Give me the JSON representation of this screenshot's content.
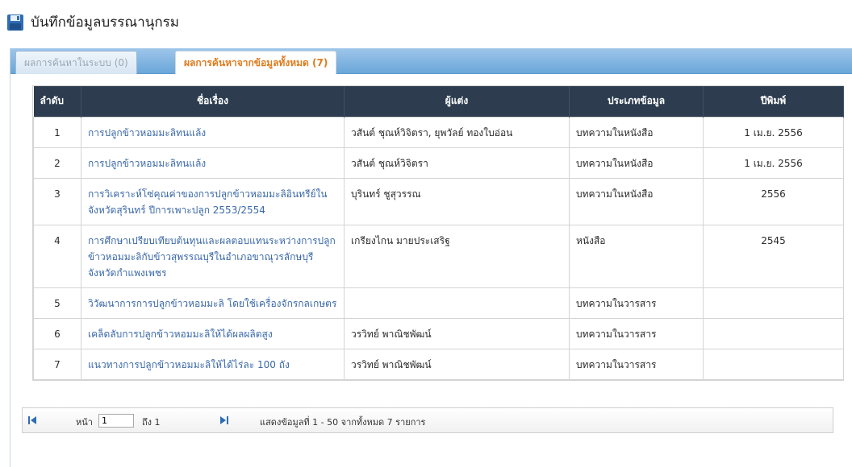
{
  "header": {
    "title": "บันทึกข้อมูลบรรณานุกรม",
    "icon": "save-icon"
  },
  "tabs": [
    {
      "label": "ผลการค้นหาในระบบ (0)",
      "active": false
    },
    {
      "label": "ผลการค้นหาจากข้อมูลทั้งหมด  (7)",
      "active": true
    }
  ],
  "table": {
    "columns": [
      "ลำดับ",
      "ชื่อเรื่อง",
      "ผู้แต่ง",
      "ประเภทข้อมูล",
      "ปีพิมพ์"
    ],
    "rows": [
      {
        "num": "1",
        "title": "การปลูกข้าวหอมมะลิทนแล้ง",
        "author": "วสันต์ ชุณห์วิจิตรา, ยุพวัลย์ ทองใบอ่อน",
        "type": "บทความในหนังสือ",
        "year": "1 เม.ย. 2556"
      },
      {
        "num": "2",
        "title": "การปลูกข้าวหอมมะลิทนแล้ง",
        "author": "วสันต์ ชุณห์วิจิตรา",
        "type": "บทความในหนังสือ",
        "year": "1 เม.ย. 2556"
      },
      {
        "num": "3",
        "title": "การวิเคราะห์โซ่คุณค่าของการปลูกข้าวหอมมะลิอินทรีย์ในจังหวัดสุรินทร์ ปีการเพาะปลูก 2553/2554",
        "author": "บุรินทร์ ชูสุวรรณ",
        "type": "บทความในหนังสือ",
        "year": "2556"
      },
      {
        "num": "4",
        "title": "การศึกษาเปรียบเทียบต้นทุนและผลตอบแทนระหว่างการปลูกข้าวหอมมะลิกับข้าวสุพรรณบุรีในอำเภอขาณุวรลักษบุรี จังหวัดกำแพงเพชร",
        "author": "เกรียงไกน มายประเสริฐ",
        "type": "หนังสือ",
        "year": "2545"
      },
      {
        "num": "5",
        "title": "วิวัฒนาการการปลูกข้าวหอมมะลิ โดยใช้เครื่องจักรกลเกษตร",
        "author": "",
        "type": "บทความในวารสาร",
        "year": ""
      },
      {
        "num": "6",
        "title": "เคล็ดลับการปลูกข้าวหอมมะลิให้ได้ผลผลิตสูง",
        "author": "วรวิทย์ พาณิชพัฒน์",
        "type": "บทความในวารสาร",
        "year": ""
      },
      {
        "num": "7",
        "title": "แนวทางการปลูกข้าวหอมมะลิให้ได้ไร่ละ 100 ถัง",
        "author": "วรวิทย์ พาณิชพัฒน์",
        "type": "บทความในวารสาร",
        "year": ""
      }
    ]
  },
  "pager": {
    "page_label": "หน้า",
    "page_value": "1",
    "of_label": "ถึง 1",
    "info": "แสดงข้อมูลที่ 1 - 50 จากทั้งหมด 7 รายการ"
  },
  "colors": {
    "header_bg": "#2d3d4f",
    "link": "#3a68a8",
    "active_tab_text": "#e07a1b",
    "tabbar": "#6aa7d9"
  }
}
